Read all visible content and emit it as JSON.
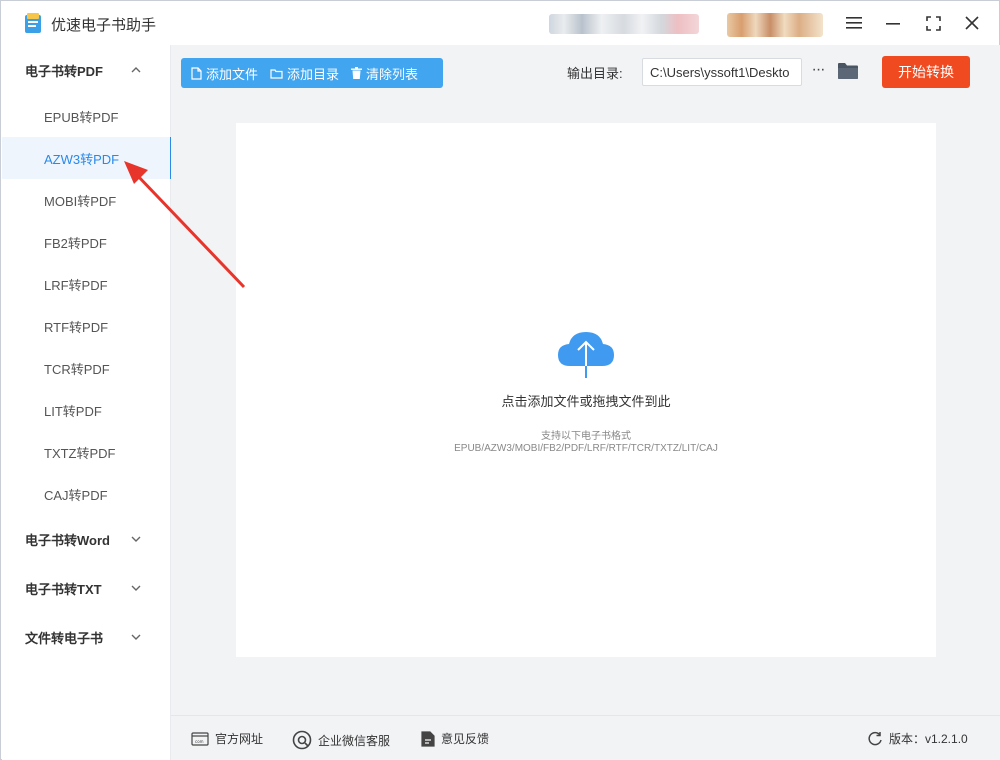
{
  "app": {
    "title": "优速电子书助手"
  },
  "window_controls": {
    "menu_icon": "hamburger-icon",
    "minimize_icon": "minimize-icon",
    "fullscreen_icon": "fullscreen-icon",
    "close_icon": "close-icon"
  },
  "sidebar": {
    "groups": [
      {
        "label": "电子书转PDF",
        "expanded": true,
        "items": [
          "EPUB转PDF",
          "AZW3转PDF",
          "MOBI转PDF",
          "FB2转PDF",
          "LRF转PDF",
          "RTF转PDF",
          "TCR转PDF",
          "LIT转PDF",
          "TXTZ转PDF",
          "CAJ转PDF"
        ],
        "active_item": "AZW3转PDF"
      },
      {
        "label": "电子书转Word",
        "expanded": false
      },
      {
        "label": "电子书转TXT",
        "expanded": false
      },
      {
        "label": "文件转电子书",
        "expanded": false
      }
    ]
  },
  "toolbar": {
    "add_file": "添加文件",
    "add_folder": "添加目录",
    "clear_list": "清除列表"
  },
  "output": {
    "label": "输出目录:",
    "path": "C:\\Users\\yssoft1\\Deskto",
    "more": "···"
  },
  "start_button": "开始转换",
  "dropzone": {
    "title": "点击添加文件或拖拽文件到此",
    "subtitle": "支持以下电子书格式",
    "formats": "EPUB/AZW3/MOBI/FB2/PDF/LRF/RTF/TCR/TXTZ/LIT/CAJ"
  },
  "footer": {
    "website": "官方网址",
    "wechat": "企业微信客服",
    "feedback": "意见反馈",
    "version": "版本：v1.2.1.0"
  },
  "colors": {
    "accent": "#2b89e8",
    "toolbar_bg": "#41a5f0",
    "start_bg": "#f04a20",
    "annotation_arrow": "#e8352b"
  }
}
